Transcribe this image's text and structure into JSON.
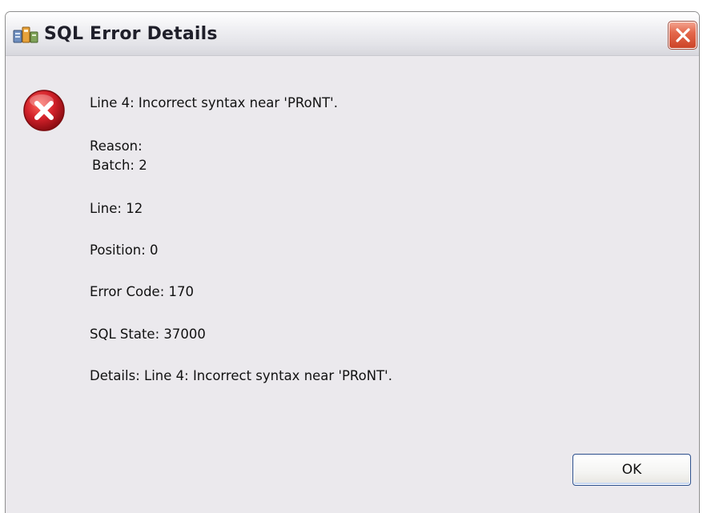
{
  "window": {
    "title": "SQL Error Details"
  },
  "error": {
    "headline": "Line 4: Incorrect syntax near 'PRoNT'.",
    "reason_label": "Reason:",
    "batch": "Batch: 2",
    "line": "Line: 12",
    "position": "Position: 0",
    "error_code": "Error Code: 170",
    "sql_state": "SQL State: 37000",
    "details": "Details: Line 4: Incorrect syntax near 'PRoNT'."
  },
  "buttons": {
    "ok_label": "OK"
  },
  "icons": {
    "app": "database-app-icon",
    "error": "error-icon",
    "close": "close-icon"
  },
  "colors": {
    "error_red": "#d2212a",
    "close_button": "#e4684c",
    "dialog_background": "#ebe9ed"
  }
}
